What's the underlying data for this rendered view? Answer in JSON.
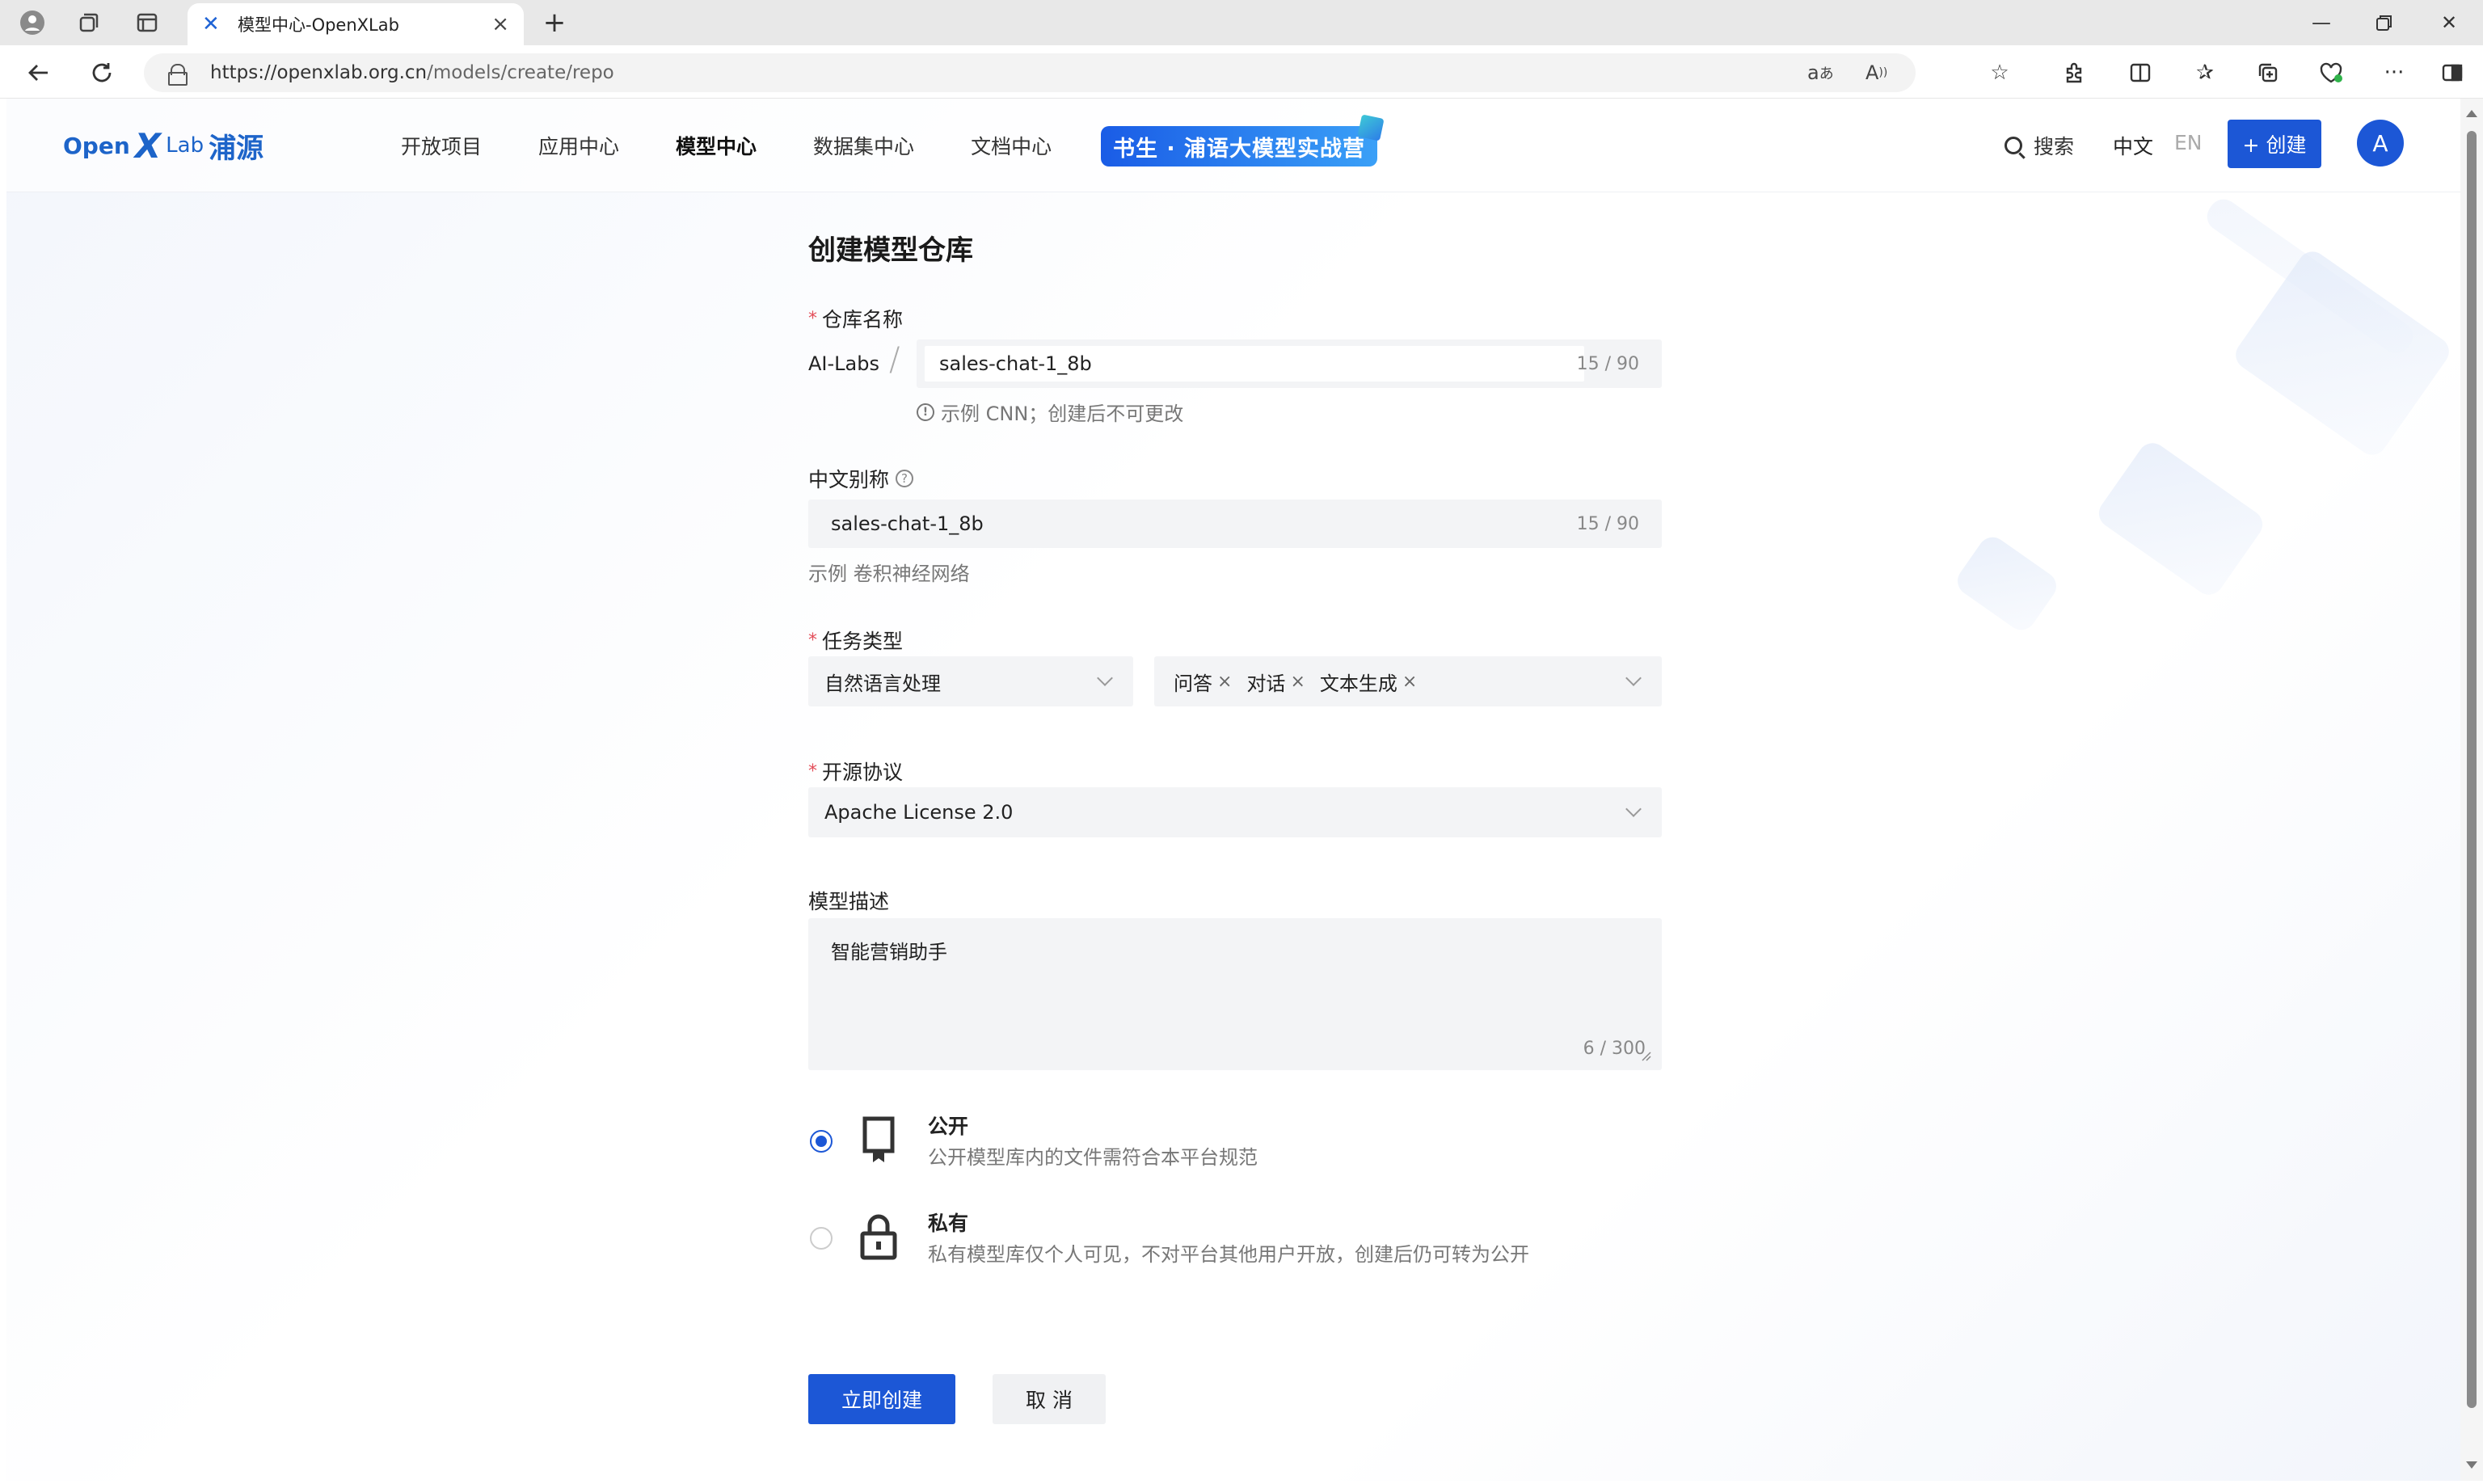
{
  "browser": {
    "tab_title": "模型中心-OpenXLab",
    "url_host": "https://openxlab.org.cn",
    "url_path": "/models/create/repo"
  },
  "site": {
    "logo_open": "Open",
    "logo_lab": "Lab",
    "logo_cn": "浦源",
    "nav": [
      "开放项目",
      "应用中心",
      "模型中心",
      "数据集中心",
      "文档中心"
    ],
    "promo": "书生 · 浦语大模型实战营",
    "search": "搜索",
    "lang_zh": "中文",
    "lang_en": "EN",
    "create": "+ 创建",
    "avatar": "A"
  },
  "form": {
    "title": "创建模型仓库",
    "repo_name": {
      "label": "仓库名称",
      "owner": "AI-Labs",
      "value": "sales-chat-1_8b",
      "count": "15 / 90",
      "hint": "示例 CNN；创建后不可更改"
    },
    "alias": {
      "label": "中文别称",
      "value": "sales-chat-1_8b",
      "count": "15 / 90",
      "hint": "示例 卷积神经网络"
    },
    "task": {
      "label": "任务类型",
      "category": "自然语言处理",
      "tags": [
        "问答",
        "对话",
        "文本生成"
      ]
    },
    "license": {
      "label": "开源协议",
      "value": "Apache License 2.0"
    },
    "description": {
      "label": "模型描述",
      "value": "智能营销助手",
      "count": "6 / 300"
    },
    "visibility": [
      {
        "title": "公开",
        "desc": "公开模型库内的文件需符合本平台规范",
        "selected": true
      },
      {
        "title": "私有",
        "desc": "私有模型库仅个人可见，不对平台其他用户开放，创建后仍可转为公开",
        "selected": false
      }
    ],
    "submit": "立即创建",
    "cancel": "取 消"
  },
  "colors": {
    "primary": "#1c57d6",
    "required": "#e34d59"
  }
}
